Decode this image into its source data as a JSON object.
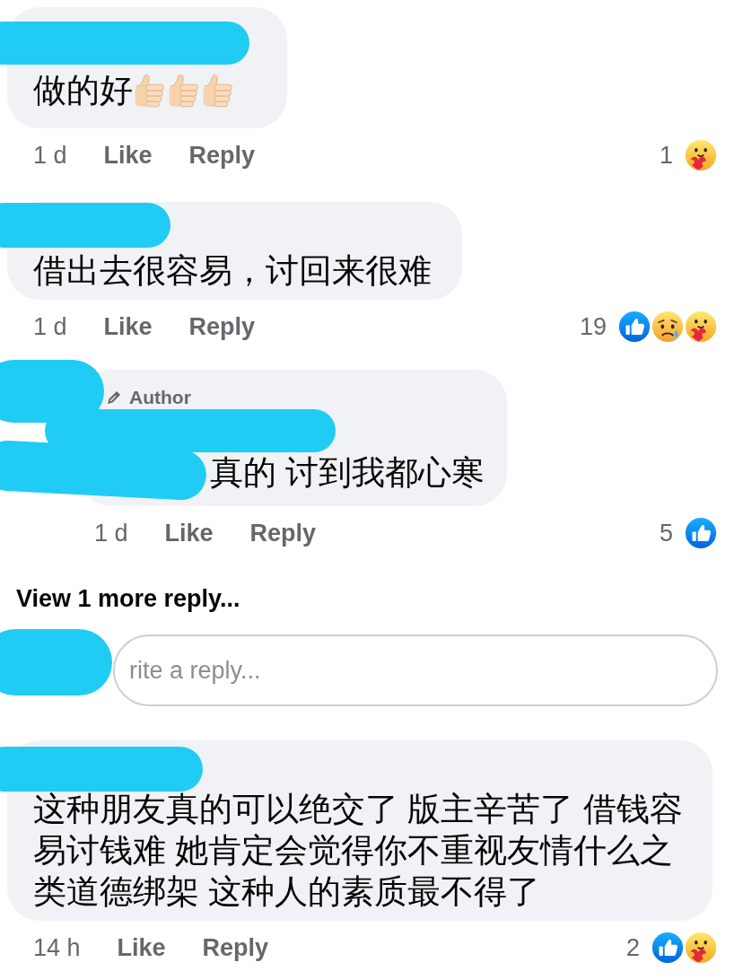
{
  "comments": [
    {
      "text": "做的好",
      "emojis": [
        {
          "kind": "thumbs-up"
        },
        {
          "kind": "thumbs-up"
        },
        {
          "kind": "thumbs-up"
        }
      ],
      "time": "1 d",
      "actions": [
        "Like",
        "Reply"
      ],
      "reaction_count": "1",
      "reactions": [
        {
          "kind": "care"
        }
      ]
    },
    {
      "text": "借出去很容易，讨回来很难",
      "time": "1 d",
      "actions": [
        "Like",
        "Reply"
      ],
      "reaction_count": "19",
      "reactions": [
        {
          "kind": "like"
        },
        {
          "kind": "sad"
        },
        {
          "kind": "care"
        }
      ],
      "replies": [
        {
          "badge": "Author",
          "text": "真的 讨到我都心寒",
          "time": "1 d",
          "actions": [
            "Like",
            "Reply"
          ],
          "reaction_count": "5",
          "reactions": [
            {
              "kind": "like"
            }
          ]
        }
      ],
      "more_replies": "View 1 more reply...",
      "reply_field": {
        "placeholder": "rite a reply..."
      }
    },
    {
      "text": "这种朋友真的可以绝交了 版主辛苦了 借钱容易讨钱难 她肯定会觉得你不重视友情什么之类道德绑架 这种人的素质最不得了",
      "time": "14 h",
      "actions": [
        "Like",
        "Reply"
      ],
      "reaction_count": "2",
      "reactions": [
        {
          "kind": "like"
        },
        {
          "kind": "care"
        }
      ]
    }
  ]
}
